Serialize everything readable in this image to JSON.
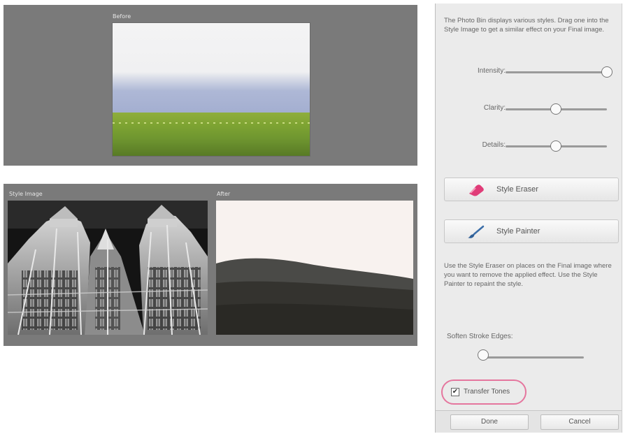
{
  "top_preview": {
    "label": "Before"
  },
  "bottom_preview": {
    "left_label": "Style Image",
    "right_label": "After"
  },
  "sidebar": {
    "intro": "The Photo Bin displays various styles. Drag one into the Style Image to get a similar effect on your Final image.",
    "sliders": [
      {
        "label": "Intensity:",
        "value": 1.0
      },
      {
        "label": "Clarity:",
        "value": 0.5
      },
      {
        "label": "Details:",
        "value": 0.5
      }
    ],
    "style_eraser_label": "Style Eraser",
    "style_painter_label": "Style Painter",
    "help": "Use the Style Eraser on places on the Final image where you want to remove the applied effect. Use the Style Painter to repaint the style.",
    "soften_label": "Soften Stroke Edges:",
    "soften_value": 0.0,
    "transfer_tones_label": "Transfer Tones",
    "transfer_tones_checked": true,
    "done_label": "Done",
    "cancel_label": "Cancel"
  }
}
